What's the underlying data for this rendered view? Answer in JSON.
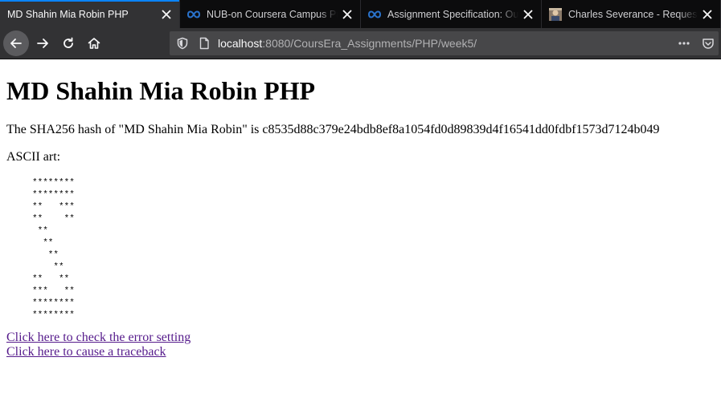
{
  "tabs": [
    {
      "title": "MD Shahin Mia Robin PHP",
      "favicon": "none",
      "active": true
    },
    {
      "title": "NUB-on Coursera Campus Program",
      "favicon": "coursera-infinity-icon",
      "active": false
    },
    {
      "title": "Assignment Specification: Our",
      "favicon": "coursera-infinity-icon",
      "active": false
    },
    {
      "title": "Charles Severance - Request/Res",
      "favicon": "profile-photo-icon",
      "active": false
    }
  ],
  "nav": {
    "url_host": "localhost",
    "url_rest": ":8080/CoursEra_Assignments/PHP/week5/"
  },
  "page": {
    "heading": "MD Shahin Mia Robin PHP",
    "hash_line": "The SHA256 hash of \"MD Shahin Mia Robin\" is c8535d88c379e24bdb8ef8a1054fd0d89839d4f16541dd0fdbf1573d7124b049",
    "ascii_label": "ASCII art:",
    "ascii_art": "********\n********\n**   ***\n**    **\n **\n  **\n   **\n    **\n**   **\n***   **\n********\n********",
    "link_error": "Click here to check the error setting",
    "link_traceback": "Click here to cause a traceback"
  },
  "colors": {
    "tab_accent": "#0a84ff",
    "visited_link": "#551a8b",
    "coursera_blue": "#2a73cc"
  }
}
